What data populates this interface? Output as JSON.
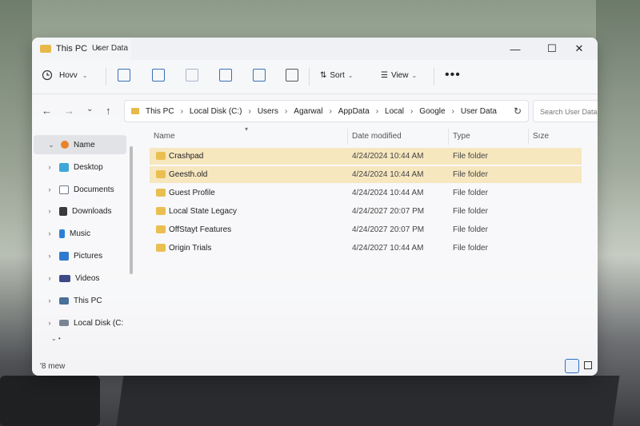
{
  "window": {
    "tab_title": "This PC",
    "tab_close": "×",
    "breadcrumb_top": "User Data",
    "controls": {
      "minimize": "—",
      "maximize": "☐",
      "close": "✕"
    }
  },
  "toolbar": {
    "new_label": "Hovv",
    "sort_label": "Sort",
    "view_label": "View",
    "more_label": "•••"
  },
  "nav": {
    "back": "←",
    "forward": "→",
    "recent": "⌄",
    "up": "↑"
  },
  "address": {
    "crumbs": [
      "This PC",
      "Local Disk (C:)",
      "Users",
      "Agarwal",
      "AppData",
      "Local",
      "Google",
      "User Data"
    ],
    "separator": "›",
    "refresh": "↻"
  },
  "search": {
    "placeholder": "Search User Data"
  },
  "sidebar": {
    "items": [
      {
        "label": "Name",
        "chevron": "⌄",
        "icon_color": "#e8832a"
      },
      {
        "label": "Desktop",
        "chevron": "›",
        "icon_color": "#3ea7d8"
      },
      {
        "label": "Documents",
        "chevron": "›",
        "icon_color": "#6f7a8a"
      },
      {
        "label": "Downloads",
        "chevron": "›",
        "icon_color": "#3a3a3a"
      },
      {
        "label": "Music",
        "chevron": "›",
        "icon_color": "#2d7fd6"
      },
      {
        "label": "Pictures",
        "chevron": "›",
        "icon_color": "#2f7ad0"
      },
      {
        "label": "Videos",
        "chevron": "›",
        "icon_color": "#3d4a8a"
      },
      {
        "label": "This PC",
        "chevron": "›",
        "icon_color": "#4a6f99"
      },
      {
        "label": "Local Disk (C:",
        "chevron": "›",
        "icon_color": "#7b8593"
      }
    ]
  },
  "columns": {
    "name": "Name",
    "date": "Date modified",
    "type": "Type",
    "size": "Sıze"
  },
  "files": [
    {
      "name": "Crashpad",
      "date": "4/24/2024 10:44 AM",
      "type": "File folder",
      "selected": true
    },
    {
      "name": "Geesth.old",
      "date": "4/24/2024 10:44 AM",
      "type": "File folder",
      "selected": true
    },
    {
      "name": "Guest Profile",
      "date": "4/24/2024 10:44 AM",
      "type": "File folder",
      "selected": false
    },
    {
      "name": "Local State Legacy",
      "date": "4/24/2027 20:07 PM",
      "type": "File folder",
      "selected": false
    },
    {
      "name": "OffStayt Features",
      "date": "4/24/2027 20:07 PM",
      "type": "File folder",
      "selected": false
    },
    {
      "name": "Origin Trials",
      "date": "4/24/2027 10:44 AM",
      "type": "File folder",
      "selected": false
    }
  ],
  "status": {
    "count": "'8 mew"
  },
  "colors": {
    "folder": "#eabf52",
    "selection": "#f6dda0",
    "accent": "#2f6fbf"
  }
}
